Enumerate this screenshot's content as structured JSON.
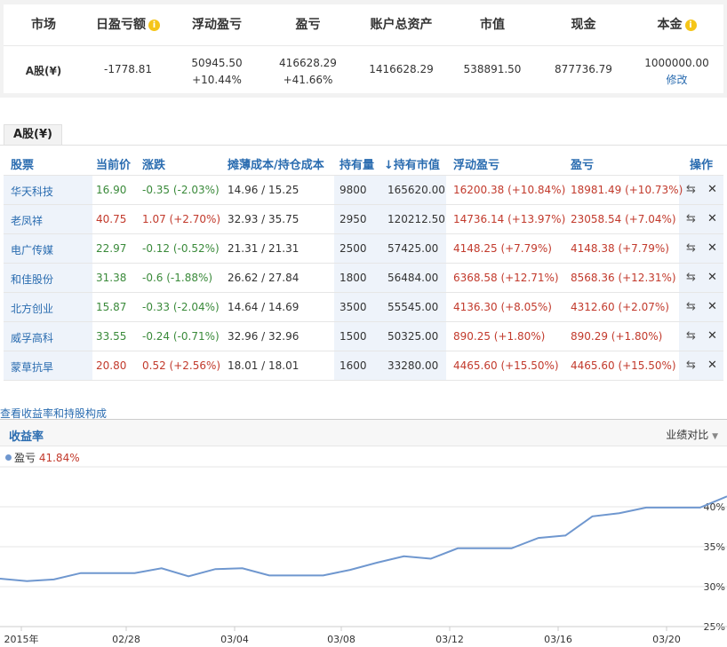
{
  "summary": {
    "headers": {
      "market": "市场",
      "daily_pnl": "日盈亏额",
      "floating_pnl": "浮动盈亏",
      "pnl": "盈亏",
      "total_assets": "账户总资产",
      "market_value": "市值",
      "cash": "现金",
      "principal": "本金"
    },
    "row": {
      "market": "A股(¥)",
      "daily_pnl": "-1778.81",
      "floating_pnl": "50945.50",
      "floating_pnl_pct": "+10.44%",
      "pnl": "416628.29",
      "pnl_pct": "+41.66%",
      "total_assets": "1416628.29",
      "market_value": "538891.50",
      "cash": "877736.79",
      "principal": "1000000.00",
      "edit_label": "修改"
    },
    "info_icon": "i"
  },
  "tab": {
    "label": "A股(¥)"
  },
  "table": {
    "columns": [
      "股票",
      "当前价",
      "涨跌",
      "摊薄成本/持仓成本",
      "持有量",
      "持有市值",
      "浮动盈亏",
      "盈亏",
      "操作"
    ],
    "sort_icon": "↓",
    "rows": [
      {
        "name": "华天科技",
        "price": "16.90",
        "change": "-0.35 (-2.03%)",
        "cost": "14.96 / 15.25",
        "qty": "9800",
        "value": "165620.00",
        "float_pnl": "16200.38 (+10.84%)",
        "pnl": "18981.49 (+10.73%)",
        "dir": "down"
      },
      {
        "name": "老凤祥",
        "price": "40.75",
        "change": "1.07 (+2.70%)",
        "cost": "32.93 / 35.75",
        "qty": "2950",
        "value": "120212.50",
        "float_pnl": "14736.14 (+13.97%)",
        "pnl": "23058.54 (+7.04%)",
        "dir": "up"
      },
      {
        "name": "电广传媒",
        "price": "22.97",
        "change": "-0.12 (-0.52%)",
        "cost": "21.31 / 21.31",
        "qty": "2500",
        "value": "57425.00",
        "float_pnl": "4148.25 (+7.79%)",
        "pnl": "4148.38 (+7.79%)",
        "dir": "down"
      },
      {
        "name": "和佳股份",
        "price": "31.38",
        "change": "-0.6 (-1.88%)",
        "cost": "26.62 / 27.84",
        "qty": "1800",
        "value": "56484.00",
        "float_pnl": "6368.58 (+12.71%)",
        "pnl": "8568.36 (+12.31%)",
        "dir": "down"
      },
      {
        "name": "北方创业",
        "price": "15.87",
        "change": "-0.33 (-2.04%)",
        "cost": "14.64 / 14.69",
        "qty": "3500",
        "value": "55545.00",
        "float_pnl": "4136.30 (+8.05%)",
        "pnl": "4312.60 (+2.07%)",
        "dir": "down"
      },
      {
        "name": "威孚高科",
        "price": "33.55",
        "change": "-0.24 (-0.71%)",
        "cost": "32.96 / 32.96",
        "qty": "1500",
        "value": "50325.00",
        "float_pnl": "890.25 (+1.80%)",
        "pnl": "890.29 (+1.80%)",
        "dir": "down"
      },
      {
        "name": "蒙草抗旱",
        "price": "20.80",
        "change": "0.52 (+2.56%)",
        "cost": "18.01 / 18.01",
        "qty": "1600",
        "value": "33280.00",
        "float_pnl": "4465.60 (+15.50%)",
        "pnl": "4465.60 (+15.50%)",
        "dir": "up"
      }
    ],
    "ops": {
      "transfer_icon": "⇆",
      "delete_icon": "✕"
    }
  },
  "view_link": "查看收益率和持股构成",
  "chart_panel": {
    "title": "收益率",
    "compare_label": "业绩对比",
    "legend_name": "盈亏",
    "legend_value": "41.84%"
  },
  "colors": {
    "link": "#2a6cb0",
    "up": "#c23a2c",
    "down": "#3a8a3a",
    "line": "#6f97cf"
  },
  "chart_data": {
    "type": "line",
    "x_labels": [
      "2015年",
      "02/28",
      "03/04",
      "03/08",
      "03/12",
      "03/16",
      "03/20"
    ],
    "y_labels": [
      "25%",
      "30%",
      "35%",
      "40%"
    ],
    "ylim": [
      25,
      42
    ],
    "series": [
      {
        "name": "盈亏",
        "values": [
          31.0,
          30.7,
          30.9,
          31.7,
          31.7,
          31.7,
          32.3,
          31.3,
          32.2,
          32.3,
          31.4,
          31.4,
          31.4,
          32.1,
          33.0,
          33.8,
          33.5,
          34.8,
          34.8,
          34.8,
          36.1,
          36.4,
          38.8,
          39.2,
          39.9,
          39.9,
          39.9,
          41.3
        ]
      }
    ]
  }
}
